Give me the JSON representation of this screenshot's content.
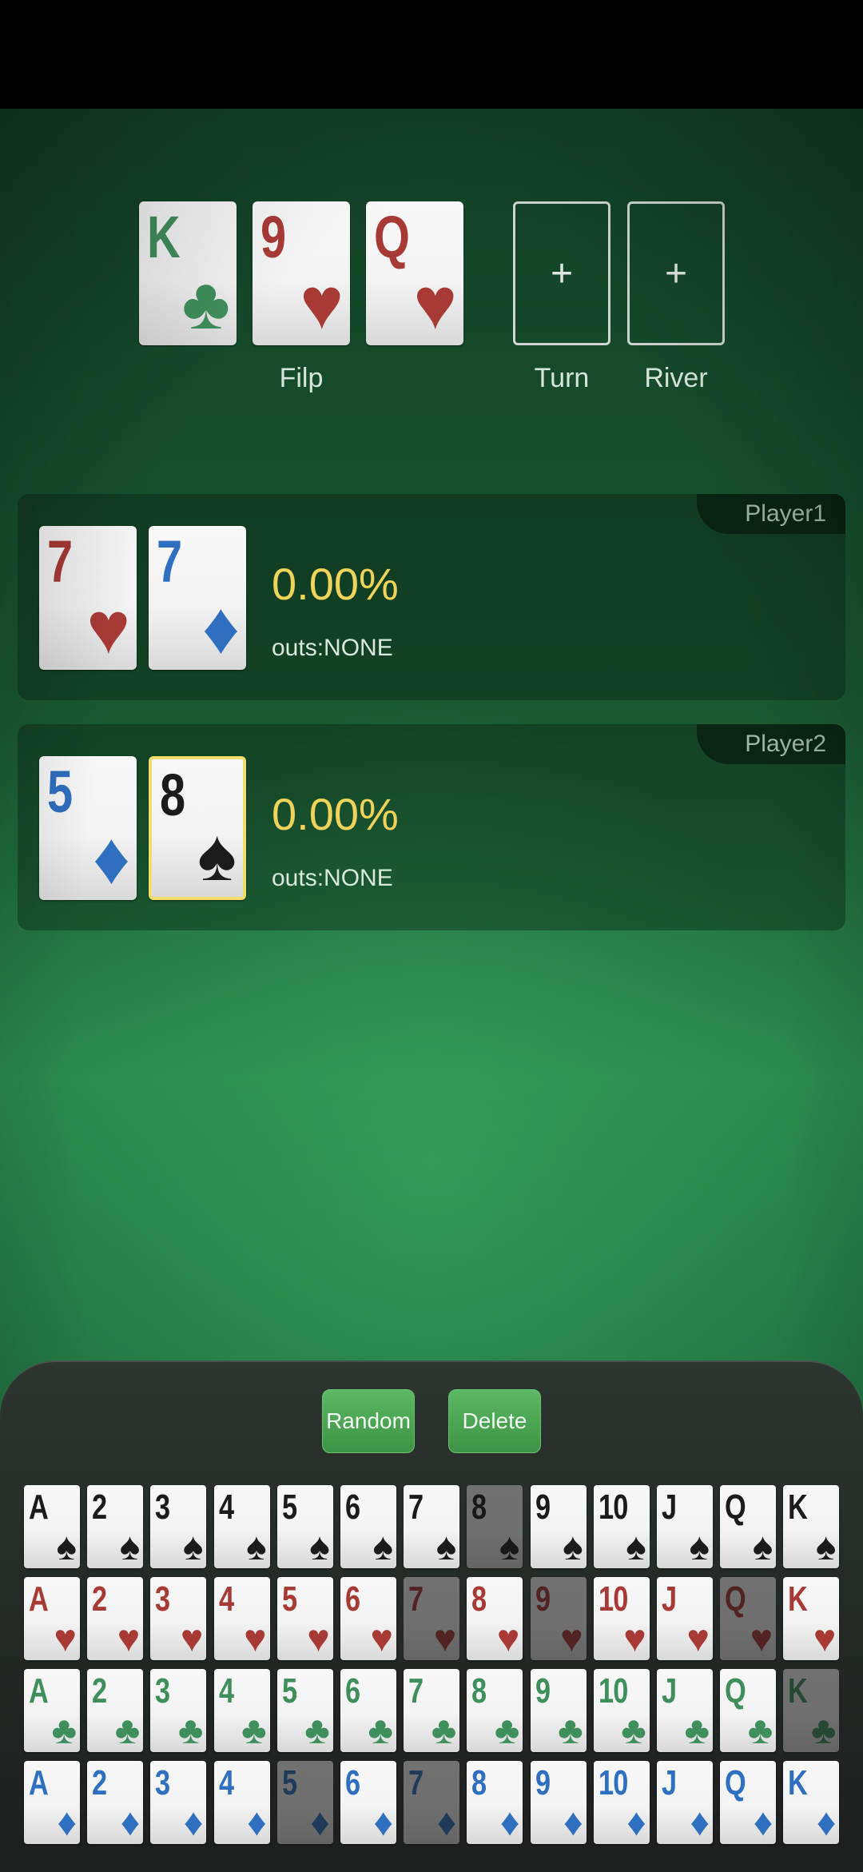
{
  "colors": {
    "spades": "#1b1b1b",
    "hearts": "#a83a36",
    "clubs": "#3f8f5c",
    "diamonds": "#2f6fbf",
    "equity_text": "#f0d35a",
    "selected_border": "#f2dc6b",
    "button_green": "#4aa452"
  },
  "board": {
    "flop": [
      {
        "rank": "K",
        "suit": "clubs",
        "suit_icon": "♣"
      },
      {
        "rank": "9",
        "suit": "hearts",
        "suit_icon": "♥"
      },
      {
        "rank": "Q",
        "suit": "hearts",
        "suit_icon": "♥"
      }
    ],
    "flop_label": "Filp",
    "turn": {
      "placeholder": "+",
      "label": "Turn"
    },
    "river": {
      "placeholder": "+",
      "label": "River"
    }
  },
  "players": [
    {
      "name": "Player1",
      "cards": [
        {
          "rank": "7",
          "suit": "hearts",
          "suit_icon": "♥",
          "selected": false
        },
        {
          "rank": "7",
          "suit": "diamonds",
          "suit_icon": "♦",
          "selected": false
        }
      ],
      "equity": "0.00%",
      "outs": "outs:NONE"
    },
    {
      "name": "Player2",
      "cards": [
        {
          "rank": "5",
          "suit": "diamonds",
          "suit_icon": "♦",
          "selected": false
        },
        {
          "rank": "8",
          "suit": "spades",
          "suit_icon": "♠",
          "selected": true
        }
      ],
      "equity": "0.00%",
      "outs": "outs:NONE"
    }
  ],
  "picker": {
    "random_label": "Random",
    "delete_label": "Delete",
    "ranks": [
      "A",
      "2",
      "3",
      "4",
      "5",
      "6",
      "7",
      "8",
      "9",
      "10",
      "J",
      "Q",
      "K"
    ],
    "rows": [
      {
        "suit": "spades",
        "suit_icon": "♠",
        "used": [
          "8"
        ]
      },
      {
        "suit": "hearts",
        "suit_icon": "♥",
        "used": [
          "7",
          "9",
          "Q"
        ]
      },
      {
        "suit": "clubs",
        "suit_icon": "♣",
        "used": [
          "K"
        ]
      },
      {
        "suit": "diamonds",
        "suit_icon": "♦",
        "used": [
          "5",
          "7"
        ]
      }
    ]
  }
}
